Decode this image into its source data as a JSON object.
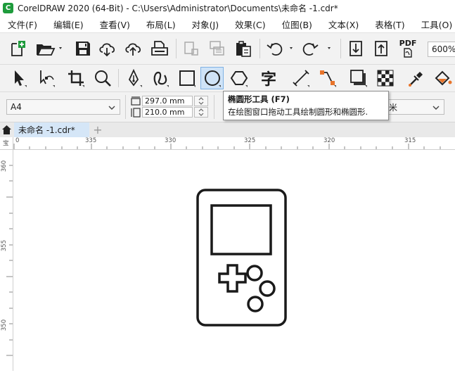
{
  "window": {
    "title": "CorelDRAW 2020 (64-Bit) - C:\\Users\\Administrator\\Documents\\未命名 -1.cdr*",
    "logo_letter": "C"
  },
  "menu": [
    "文件(F)",
    "编辑(E)",
    "查看(V)",
    "布局(L)",
    "对象(J)",
    "效果(C)",
    "位图(B)",
    "文本(X)",
    "表格(T)",
    "工具(O)"
  ],
  "toolbar": {
    "pdf_label": "PDF",
    "zoom": "600%"
  },
  "toolbox": {
    "text_tool_glyph": "字",
    "active_tool": "ellipse-tool"
  },
  "property_bar": {
    "page_size": "A4",
    "width": "297.0 mm",
    "height": "210.0 mm",
    "partial_dropdown_text": "米"
  },
  "tooltip": {
    "title": "椭圆形工具 (F7)",
    "description": "在绘图窗口拖动工具绘制圆形和椭圆形."
  },
  "tabs": {
    "document": "未命名 -1.cdr*",
    "add_label": "+"
  },
  "rulers": {
    "horizontal": [
      "0",
      "335",
      "330",
      "325",
      "320",
      "315"
    ],
    "vertical": [
      "360",
      "355",
      "350"
    ],
    "corner_label": "宝"
  },
  "colors": {
    "accent": "#1e9b3c",
    "tab_active": "#d5e6f7",
    "tool_active": "#cfe3f7",
    "drawing_stroke": "#1a1a1a",
    "orange": "#e8742a"
  }
}
